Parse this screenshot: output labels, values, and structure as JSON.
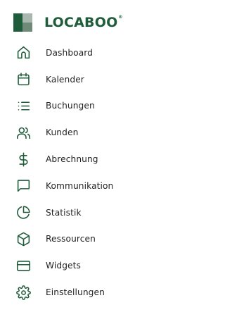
{
  "brand": {
    "name": "LOCABOO",
    "registered": "®",
    "color": "#1f5c3a"
  },
  "nav": {
    "items": [
      {
        "label": "Dashboard",
        "icon": "home-icon"
      },
      {
        "label": "Kalender",
        "icon": "calendar-icon"
      },
      {
        "label": "Buchungen",
        "icon": "list-icon"
      },
      {
        "label": "Kunden",
        "icon": "users-icon"
      },
      {
        "label": "Abrechnung",
        "icon": "dollar-icon"
      },
      {
        "label": "Kommunikation",
        "icon": "message-icon"
      },
      {
        "label": "Statistik",
        "icon": "pie-chart-icon"
      },
      {
        "label": "Ressourcen",
        "icon": "box-icon"
      },
      {
        "label": "Widgets",
        "icon": "credit-card-icon"
      },
      {
        "label": "Einstellungen",
        "icon": "gear-icon"
      }
    ]
  }
}
